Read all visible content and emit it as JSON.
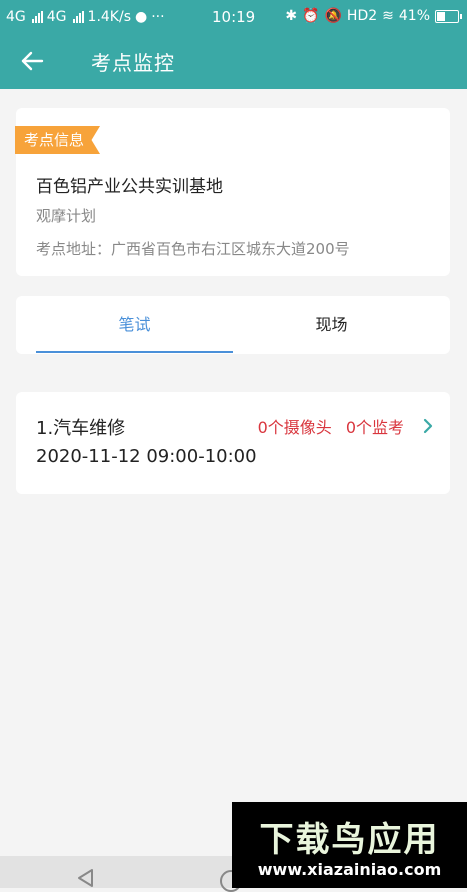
{
  "status_bar": {
    "network1": "4G",
    "network2": "4G",
    "speed": "1.4K/s",
    "more": "···",
    "time": "10:19",
    "hd": "HD2",
    "battery": "41%"
  },
  "header": {
    "title": "考点监控"
  },
  "info": {
    "badge": "考点信息",
    "site_name": "百色铝产业公共实训基地",
    "plan": "观摩计划",
    "address": "考点地址：广西省百色市右江区城东大道200号"
  },
  "tabs": {
    "written": "笔试",
    "onsite": "现场",
    "active": "written"
  },
  "exam": {
    "name": "1.汽车维修",
    "cameras": "0个摄像头",
    "proctors": "0个监考",
    "time": "2020-11-12 09:00-10:00"
  },
  "watermark": {
    "logo": "下载鸟应用",
    "url": "www.xiazainiao.com"
  },
  "colors": {
    "primary": "#3aa9a6",
    "badge": "#f7a33a",
    "tab_active": "#4a90d9",
    "alert": "#d9363e"
  }
}
